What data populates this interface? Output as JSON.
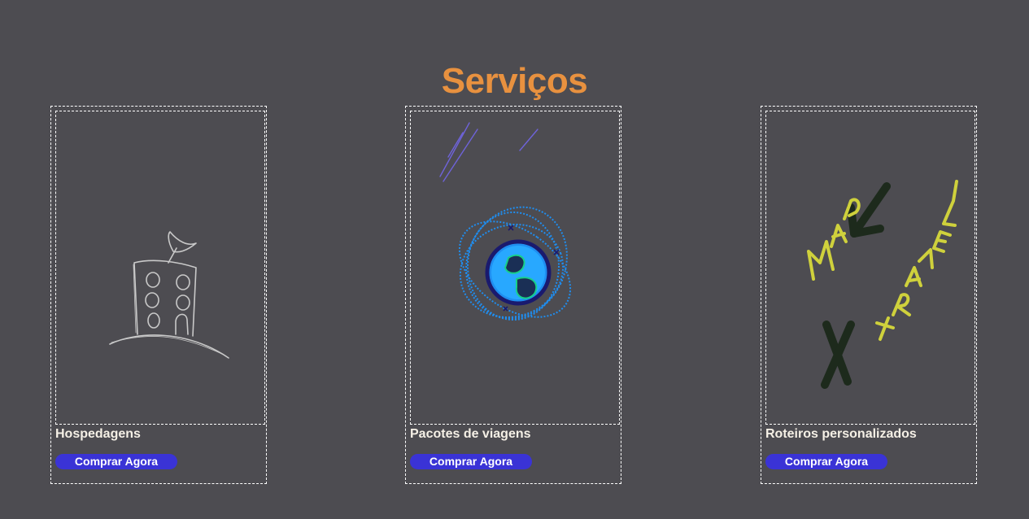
{
  "page": {
    "title": "Serviços",
    "title_color": "#e8913f",
    "background": "#4d4c51",
    "button_color": "#3a33d6"
  },
  "services": [
    {
      "title": "Hospedagens",
      "button_label": "Comprar Agora",
      "icon": "hotel-sketch-icon"
    },
    {
      "title": "Pacotes de viagens",
      "button_label": "Comprar Agora",
      "icon": "globe-sketch-icon"
    },
    {
      "title": "Roteiros personalizados",
      "button_label": "Comprar Agora",
      "icon": "map-travel-sketch-icon"
    }
  ]
}
